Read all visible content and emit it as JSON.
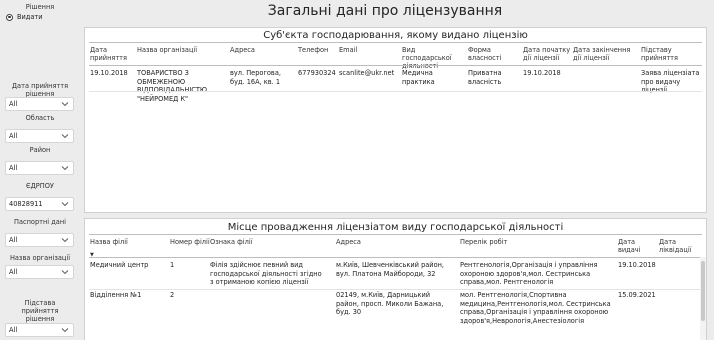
{
  "filters": {
    "decision_label": "Рішення",
    "decision_option": "Видати",
    "date_label": "Дата прийняття рішення",
    "date_value": "All",
    "region_label": "Область",
    "region_value": "All",
    "district_label": "Район",
    "district_value": "All",
    "edrpou_label": "ЄДРПОУ",
    "edrpou_value": "40828911",
    "passport_label": "Паспортні дані",
    "passport_value": "All",
    "org_label": "Назва організації",
    "org_value": "All",
    "basis_label": "Підстава прийняття рішення",
    "basis_value": "All"
  },
  "page_title": "Загальні дані про ліцензування",
  "subject_table": {
    "title": "Суб'єкта господарювання, якому видано ліцензію",
    "headers": [
      "Дата прийняття",
      "Назва організації",
      "Адреса",
      "Телефон",
      "Email",
      "Вид господарської діяльності",
      "Форма власності",
      "Дата початку дії ліцензії",
      "Дата закінчення дії ліцензії",
      "Підставу прийняття"
    ],
    "rows": [
      [
        "19.10.2018",
        "ТОВАРИСТВО З ОБМЕЖЕНОЮ ВІДПОВІДАЛЬНІСТЮ \"НЕЙРОМЕД К\"",
        "вул. Перогова, буд. 16А, кв. 1",
        "677930324",
        "scanlite@ukr.net",
        "Медична практика",
        "Приватна власність",
        "19.10.2018",
        "",
        "Заява ліцензіата про видачу ліцензії"
      ]
    ]
  },
  "branch_table": {
    "title": "Місце провадження ліцензіатом виду господарської діяльності",
    "headers": [
      "Назва філії",
      "Номер філії",
      "Ознака філії",
      "Адреса",
      "Перелік робіт",
      "Дата видачі",
      "Дата ліквідації"
    ],
    "rows": [
      [
        "Медичний центр",
        "1",
        "Філія здійснює певний вид господарської діяльності згідно з отриманою копією ліцензії",
        "м.Київ, Шевченківський район, вул. Платона Майбороди, 32",
        "Рентгенологія,Організація і управління охороною здоров'я,мол. Сестринська справа,мол. Рентгенологія",
        "19.10.2018",
        ""
      ],
      [
        "Відділення №1",
        "2",
        "",
        "02149, м.Київ, Дарницький район, просп. Миколи Бажана, буд. 30",
        "мол. Рентгенологія,Спортивна медицина,Рентгенологія,мол. Сестринська справа,Організація і управління охороною здоров'я,Неврологія,Анестезіологія",
        "15.09.2021",
        ""
      ]
    ]
  }
}
